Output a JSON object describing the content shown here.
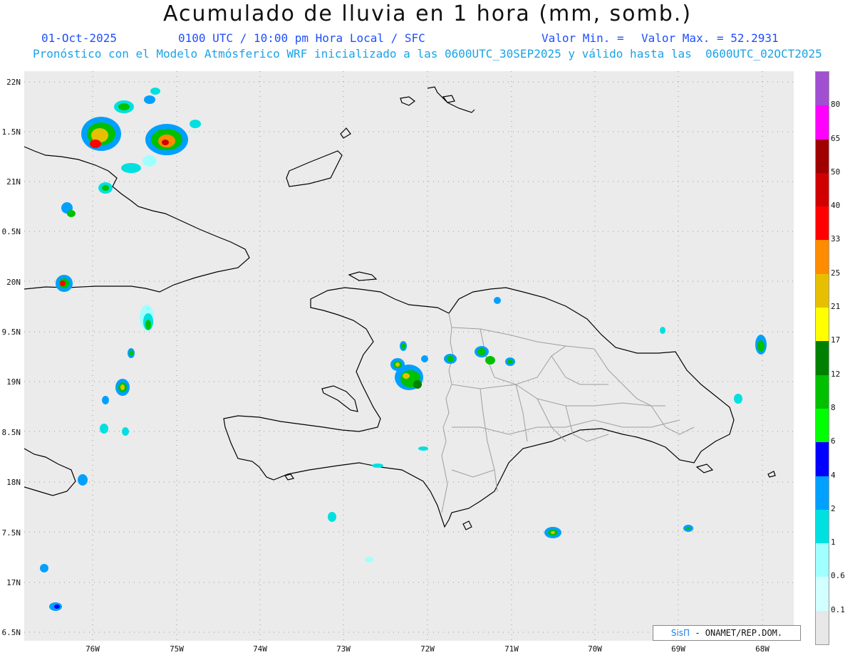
{
  "header": {
    "title": "Acumulado de lluvia en 1 hora (mm, somb.)",
    "date": "01-Oct-2025",
    "time": "0100 UTC / 10:00 pm Hora Local / SFC",
    "valor_min": "Valor Min. =",
    "valor_max": "Valor Max. = 52.2931",
    "subtitle": "Pronóstico con el Modelo Atmósferico WRF inicializado a las 0600UTC_30SEP2025 y válido hasta las  0600UTC_02OCT2025"
  },
  "lat_labels": [
    "22N",
    "1.5N",
    "21N",
    "0.5N",
    "20N",
    "9.5N",
    "19N",
    "8.5N",
    "18N",
    "7.5N",
    "17N",
    "6.5N"
  ],
  "lon_labels": [
    "76W",
    "75W",
    "74W",
    "73W",
    "72W",
    "71W",
    "70W",
    "69W",
    "68W"
  ],
  "colorbar": {
    "labels": [
      "80",
      "65",
      "50",
      "40",
      "33",
      "25",
      "21",
      "17",
      "12",
      "8",
      "6",
      "4",
      "2",
      "1",
      "0.6",
      "0.1"
    ],
    "colors": [
      "#e7e7e7",
      "#d2ffff",
      "#a0ffff",
      "#00e0e0",
      "#00a0ff",
      "#0000ff",
      "#00ff00",
      "#00c000",
      "#008000",
      "#ffff00",
      "#e6c000",
      "#ff8c00",
      "#ff0000",
      "#d00000",
      "#a00000",
      "#ff00ff",
      "#a050d0"
    ]
  },
  "credit": {
    "logo": "SisΠ",
    "text": "- ONAMET/REP.DOM."
  },
  "colors": {
    "land_line": "#000000",
    "border_line": "#9e9e9e",
    "grid_line": "#999999",
    "ocean": "#ebebeb"
  }
}
